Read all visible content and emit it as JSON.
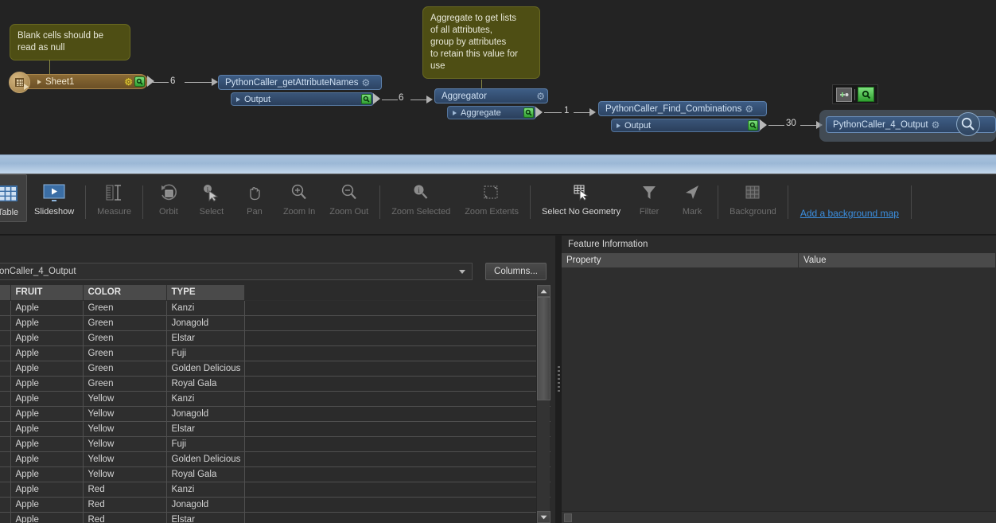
{
  "workspace": {
    "annotations": [
      {
        "id": "note-blank-cells",
        "text": "Blank cells should be\nread as null"
      },
      {
        "id": "note-aggregate",
        "text": "Aggregate to get lists\nof all attributes,\ngroup by attributes\nto retain this value for\nuse"
      }
    ],
    "nodes": [
      {
        "id": "sheet1",
        "label": "Sheet1",
        "type": "reader"
      },
      {
        "id": "pythoncaller-getattributenames",
        "label": "PythonCaller_getAttributeNames",
        "port": "Output"
      },
      {
        "id": "aggregator",
        "label": "Aggregator",
        "port": "Aggregate"
      },
      {
        "id": "pythoncaller-find-combinations",
        "label": "PythonCaller_Find_Combinations",
        "port": "Output"
      },
      {
        "id": "pythoncaller-4-output",
        "label": "PythonCaller_4_Output"
      }
    ],
    "connection_labels": [
      "6",
      "6",
      "1",
      "30"
    ]
  },
  "toolbar": {
    "items": [
      {
        "label": "Table",
        "icon": "table-icon",
        "state": "selected"
      },
      {
        "label": "Slideshow",
        "icon": "slideshow-icon",
        "state": "enabled"
      },
      {
        "label": "Measure",
        "icon": "measure-icon",
        "state": "disabled"
      },
      {
        "label": "Orbit",
        "icon": "orbit-icon",
        "state": "disabled"
      },
      {
        "label": "Select",
        "icon": "select-cursor-icon",
        "state": "disabled"
      },
      {
        "label": "Pan",
        "icon": "hand-icon",
        "state": "disabled"
      },
      {
        "label": "Zoom In",
        "icon": "zoom-in-icon",
        "state": "disabled"
      },
      {
        "label": "Zoom Out",
        "icon": "zoom-out-icon",
        "state": "disabled"
      },
      {
        "label": "Zoom Selected",
        "icon": "zoom-selected-icon",
        "state": "disabled"
      },
      {
        "label": "Zoom Extents",
        "icon": "zoom-extents-icon",
        "state": "disabled"
      },
      {
        "label": "Select No Geometry",
        "icon": "select-no-geometry-icon",
        "state": "enabled"
      },
      {
        "label": "Filter",
        "icon": "funnel-icon",
        "state": "disabled"
      },
      {
        "label": "Mark",
        "icon": "mark-arrow-icon",
        "state": "disabled"
      },
      {
        "label": "Background",
        "icon": "background-grid-icon",
        "state": "disabled"
      }
    ],
    "background_map_link": "Add a background map"
  },
  "table_panel": {
    "dataset_selector_value": "onCaller_4_Output",
    "columns_button": "Columns...",
    "columns": [
      "FRUIT",
      "COLOR",
      "TYPE"
    ],
    "rows": [
      [
        "Apple",
        "Green",
        "Kanzi"
      ],
      [
        "Apple",
        "Green",
        "Jonagold"
      ],
      [
        "Apple",
        "Green",
        "Elstar"
      ],
      [
        "Apple",
        "Green",
        "Fuji"
      ],
      [
        "Apple",
        "Green",
        "Golden Delicious"
      ],
      [
        "Apple",
        "Green",
        "Royal Gala"
      ],
      [
        "Apple",
        "Yellow",
        "Kanzi"
      ],
      [
        "Apple",
        "Yellow",
        "Jonagold"
      ],
      [
        "Apple",
        "Yellow",
        "Elstar"
      ],
      [
        "Apple",
        "Yellow",
        "Fuji"
      ],
      [
        "Apple",
        "Yellow",
        "Golden Delicious"
      ],
      [
        "Apple",
        "Yellow",
        "Royal Gala"
      ],
      [
        "Apple",
        "Red",
        "Kanzi"
      ],
      [
        "Apple",
        "Red",
        "Jonagold"
      ],
      [
        "Apple",
        "Red",
        "Elstar"
      ]
    ]
  },
  "feature_information": {
    "title": "Feature Information",
    "columns": [
      "Property",
      "Value"
    ],
    "rows": []
  },
  "colors": {
    "node_blue": "#3e5d85",
    "reader_brown": "#8a6a35",
    "annotation_olive": "#4e4e14",
    "link_blue": "#3b8fe0",
    "band_blue": "#a9c3de"
  }
}
